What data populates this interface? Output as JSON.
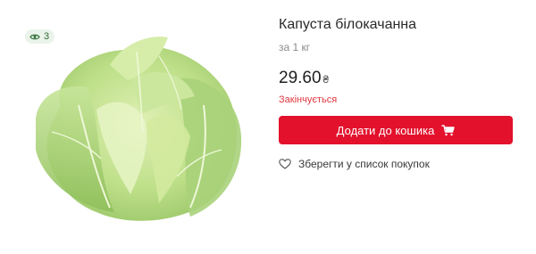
{
  "badge": {
    "views_count": "3",
    "icon": "eye-icon"
  },
  "product": {
    "image_icon": "cabbage-image",
    "title": "Капуста білокачанна",
    "unit": "за 1 кг",
    "price": "29.60",
    "currency": "₴",
    "stock_status": "Закінчується"
  },
  "actions": {
    "add_to_cart_label": "Додати до кошика",
    "add_to_cart_icon": "cart-icon",
    "wishlist_label": "Зберегти у список покупок",
    "wishlist_icon": "heart-icon"
  },
  "colors": {
    "accent": "#e3112c",
    "stock_warning": "#e0373f",
    "badge_bg": "#eaf3ea",
    "badge_text": "#2f6e36"
  }
}
